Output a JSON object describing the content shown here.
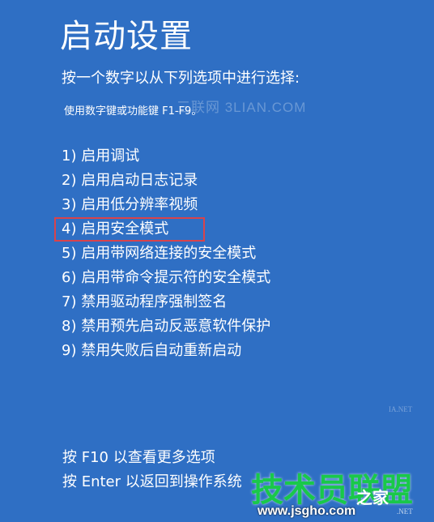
{
  "title": "启动设置",
  "prompt": "按一个数字以从下列选项中进行选择:",
  "hint": "使用数字键或功能键 F1-F9。",
  "options": [
    {
      "label": "1) 启用调试"
    },
    {
      "label": "2) 启用启动日志记录"
    },
    {
      "label": "3) 启用低分辨率视频"
    },
    {
      "label": "4) 启用安全模式",
      "selected": true
    },
    {
      "label": "5) 启用带网络连接的安全模式"
    },
    {
      "label": "6) 启用带命令提示符的安全模式"
    },
    {
      "label": "7) 禁用驱动程序强制签名"
    },
    {
      "label": "8) 禁用预先启动反恶意软件保护"
    },
    {
      "label": "9) 禁用失败后自动重新启动"
    }
  ],
  "footer": {
    "more_options": "按 F10 以查看更多选项",
    "return": "按 Enter 以返回到操作系统"
  },
  "watermarks": {
    "top": "三联网 3LIAN.COM",
    "logo": "技术员联盟",
    "brand": "之家",
    "site": "www.jsgho.com",
    "small": "IA.NET",
    "net": ".NET"
  },
  "colors": {
    "background": "#2f6fc4",
    "text": "#ffffff",
    "highlight_border": "#d9434b",
    "watermark_green": "#19c84a"
  }
}
